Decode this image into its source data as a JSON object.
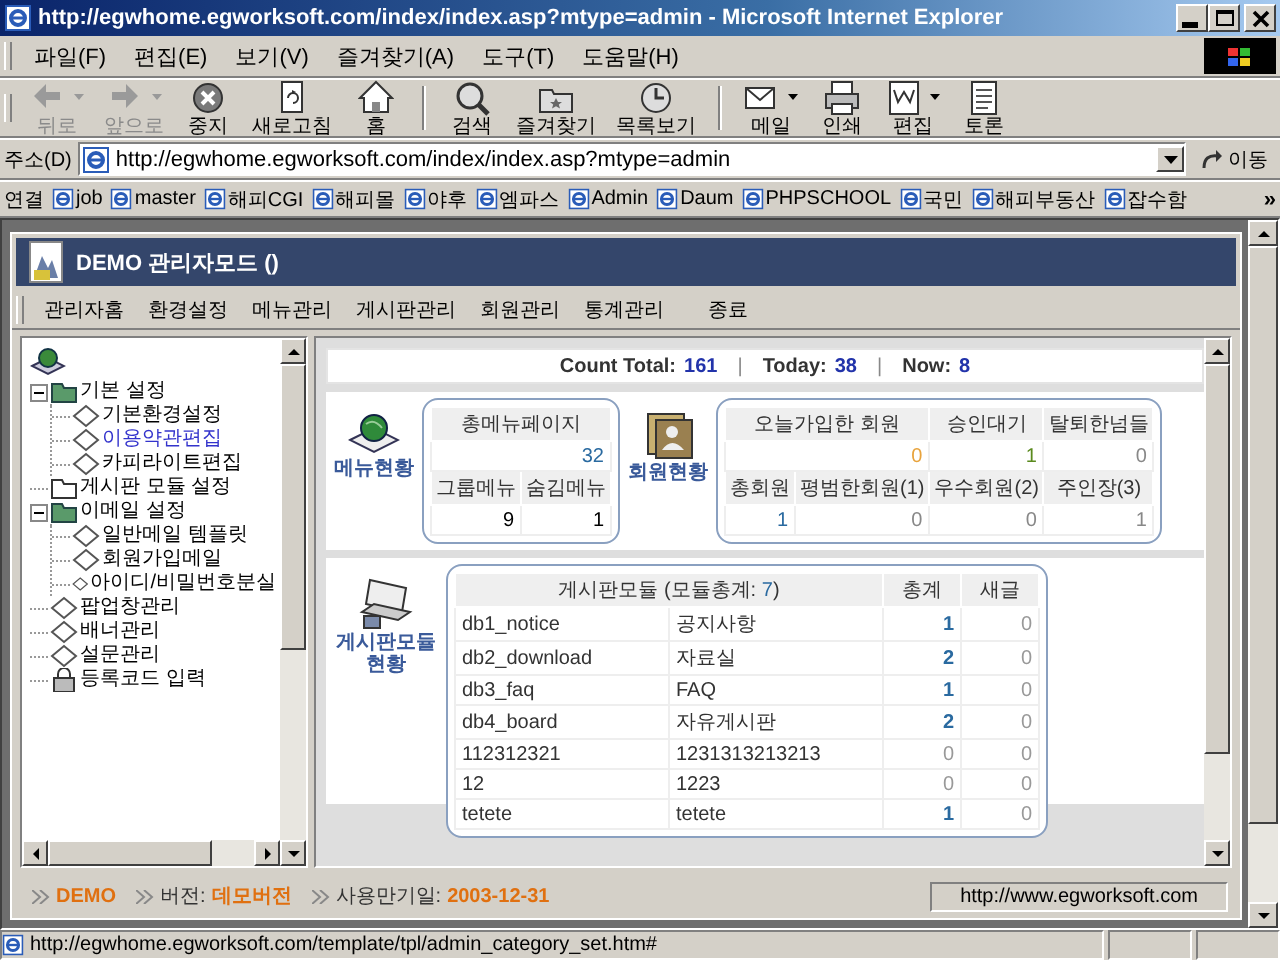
{
  "window": {
    "title": "http://egwhome.egworksoft.com/index/index.asp?mtype=admin - Microsoft Internet Explorer"
  },
  "menu_bar": [
    "파일(F)",
    "편집(E)",
    "보기(V)",
    "즐겨찾기(A)",
    "도구(T)",
    "도움말(H)"
  ],
  "toolbar_groups": [
    {
      "buttons": [
        {
          "kind": "back",
          "label": "뒤로",
          "disabled": true,
          "dropdown": true
        },
        {
          "kind": "forward",
          "label": "앞으로",
          "disabled": true,
          "dropdown": true
        },
        {
          "kind": "stop",
          "label": "중지",
          "disabled": false,
          "dropdown": false
        },
        {
          "kind": "refresh",
          "label": "새로고침",
          "disabled": false,
          "dropdown": false
        },
        {
          "kind": "home",
          "label": "홈",
          "disabled": false,
          "dropdown": false
        }
      ]
    },
    {
      "buttons": [
        {
          "kind": "search",
          "label": "검색",
          "disabled": false,
          "dropdown": false
        },
        {
          "kind": "favorites",
          "label": "즐겨찾기",
          "disabled": false,
          "dropdown": false
        },
        {
          "kind": "history",
          "label": "목록보기",
          "disabled": false,
          "dropdown": false
        }
      ]
    },
    {
      "buttons": [
        {
          "kind": "mail",
          "label": "메일",
          "disabled": false,
          "dropdown": true
        },
        {
          "kind": "print",
          "label": "인쇄",
          "disabled": false,
          "dropdown": false
        },
        {
          "kind": "edit",
          "label": "편집",
          "disabled": false,
          "dropdown": true
        },
        {
          "kind": "discuss",
          "label": "토론",
          "disabled": false,
          "dropdown": false
        }
      ]
    }
  ],
  "address": {
    "label": "주소(D)",
    "value": "http://egwhome.egworksoft.com/index/index.asp?mtype=admin",
    "go": "이동"
  },
  "links": {
    "label": "연결",
    "items": [
      "job",
      "master",
      "해피CGI",
      "해피몰",
      "야후",
      "엠파스",
      "Admin",
      "Daum",
      "PHPSCHOOL",
      "국민",
      "해피부동산",
      "잡수함"
    ],
    "more": "»"
  },
  "app": {
    "title": "DEMO 관리자모드 ()",
    "nav": [
      "관리자홈",
      "환경설정",
      "메뉴관리",
      "게시판관리",
      "회원관리",
      "통계관리",
      "종료"
    ]
  },
  "tree": [
    {
      "label": "기본 설정",
      "kind": "folder",
      "expanded": true,
      "selected": false,
      "children": [
        {
          "label": "기본환경설정",
          "kind": "page",
          "selected": false
        },
        {
          "label": "이용약관편집",
          "kind": "page",
          "selected": true
        },
        {
          "label": "카피라이트편집",
          "kind": "page",
          "selected": false
        }
      ]
    },
    {
      "label": "게시판 모듈 설정",
      "kind": "folder",
      "expanded": false,
      "selected": false
    },
    {
      "label": "이메일 설정",
      "kind": "folder",
      "expanded": true,
      "selected": false,
      "children": [
        {
          "label": "일반메일 템플릿",
          "kind": "page",
          "selected": false
        },
        {
          "label": "회원가입메일",
          "kind": "page",
          "selected": false
        },
        {
          "label": "아이디/비밀번호분실",
          "kind": "page",
          "selected": false
        }
      ]
    },
    {
      "label": "팝업창관리",
      "kind": "page",
      "selected": false
    },
    {
      "label": "배너관리",
      "kind": "page",
      "selected": false
    },
    {
      "label": "설문관리",
      "kind": "page",
      "selected": false
    },
    {
      "label": "등록코드 입력",
      "kind": "lock",
      "selected": false
    }
  ],
  "count": {
    "separator": "|",
    "items": [
      {
        "label": "Count Total:",
        "value": "161"
      },
      {
        "label": "Today:",
        "value": "38"
      },
      {
        "label": "Now:",
        "value": "8"
      }
    ]
  },
  "menu_status": {
    "label": "메뉴현황",
    "total_header": "총메뉴페이지",
    "total": "32",
    "groups": [
      {
        "header": "그룹메뉴",
        "value": "9"
      },
      {
        "header": "숨김메뉴",
        "value": "1"
      }
    ]
  },
  "member_status": {
    "label": "회원현황",
    "top": [
      {
        "header": "오늘가입한 회원",
        "value": "0",
        "color": "#e8a33c"
      },
      {
        "header": "승인대기",
        "value": "1",
        "color": "#5a8a1e"
      },
      {
        "header": "탈퇴한넘들",
        "value": "0",
        "color": "#888888"
      }
    ],
    "bottom": [
      {
        "header": "총회원",
        "value": "1",
        "color": "#2a6aa0"
      },
      {
        "header": "평범한회원(1)",
        "value": "0",
        "color": "#888888"
      },
      {
        "header": "우수회원(2)",
        "value": "0",
        "color": "#888888"
      },
      {
        "header": "주인장(3)",
        "value": "1",
        "color": "#888888"
      }
    ]
  },
  "board_status": {
    "label": "게시판모듈 현황",
    "title": "게시판모듈 (모듈총계: ",
    "count": "7",
    "title_end": ")",
    "columns": [
      "총계",
      "새글"
    ],
    "rows": [
      {
        "id": "db1_notice",
        "name": "공지사항",
        "total": "1",
        "new": "0"
      },
      {
        "id": "db2_download",
        "name": "자료실",
        "total": "2",
        "new": "0"
      },
      {
        "id": "db3_faq",
        "name": "FAQ",
        "total": "1",
        "new": "0"
      },
      {
        "id": "db4_board",
        "name": "자유게시판",
        "total": "2",
        "new": "0"
      },
      {
        "id": "112312321",
        "name": "1231313213213",
        "total": "0",
        "new": "0"
      },
      {
        "id": "12",
        "name": "1223",
        "total": "0",
        "new": "0"
      },
      {
        "id": "tetete",
        "name": "tetete",
        "total": "1",
        "new": "0"
      }
    ]
  },
  "footer": {
    "items": [
      {
        "value": "DEMO"
      },
      {
        "label": "버전:",
        "value": "데모버전"
      },
      {
        "label": "사용만기일:",
        "value": "2003-12-31"
      }
    ],
    "site": "http://www.egworksoft.com"
  },
  "status_bar": {
    "text": "http://egwhome.egworksoft.com/template/tpl/admin_category_set.htm#"
  }
}
